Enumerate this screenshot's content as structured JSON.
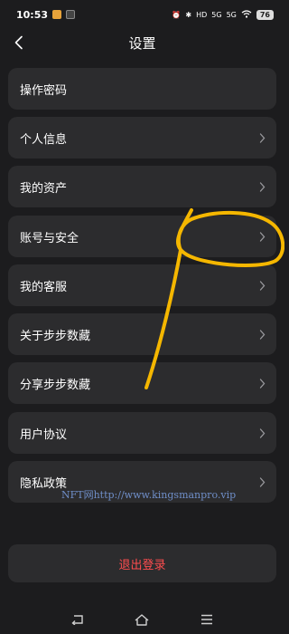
{
  "status_bar": {
    "time": "10:53",
    "right_indicators": [
      "⏰",
      "✱",
      "HD",
      "5G",
      "5G"
    ],
    "battery": "76"
  },
  "header": {
    "title": "设置",
    "back_icon": "chevron-left-icon"
  },
  "menu": {
    "items": [
      {
        "label": "操作密码",
        "has_chevron": false
      },
      {
        "label": "个人信息",
        "has_chevron": true
      },
      {
        "label": "我的资产",
        "has_chevron": true
      },
      {
        "label": "账号与安全",
        "has_chevron": true
      },
      {
        "label": "我的客服",
        "has_chevron": true
      },
      {
        "label": "关于步步数藏",
        "has_chevron": true
      },
      {
        "label": "分享步步数藏",
        "has_chevron": true
      },
      {
        "label": "用户协议",
        "has_chevron": true
      },
      {
        "label": "隐私政策",
        "has_chevron": true
      }
    ]
  },
  "watermark": "NFT网http://www.kingsmanpro.vip",
  "logout": {
    "label": "退出登录"
  },
  "nav_bar": {
    "icons": [
      "back-icon",
      "home-icon",
      "menu-icon"
    ]
  },
  "colors": {
    "background": "#1c1c1e",
    "card": "#2c2c2e",
    "logout_text": "#ff4d4f",
    "annotation": "#f5b700",
    "watermark": "#6f8ec8"
  }
}
